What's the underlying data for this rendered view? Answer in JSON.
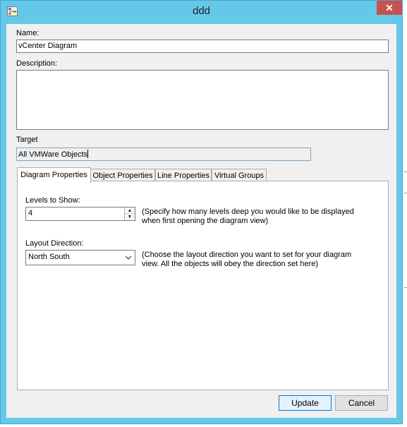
{
  "window": {
    "title": "ddd",
    "close_glyph": "✕",
    "app_icon": "diagram-app-icon"
  },
  "form": {
    "name_label": "Name:",
    "name_value": "vCenter Diagram",
    "description_label": "Description:",
    "description_value": "",
    "target_label": "Target",
    "target_value": "All VMWare Objects"
  },
  "tabs": [
    {
      "label": "Diagram Properties",
      "active": true
    },
    {
      "label": "Object Properties",
      "active": false
    },
    {
      "label": "Line Properties",
      "active": false
    },
    {
      "label": "Virtual Groups",
      "active": false
    }
  ],
  "diagram_properties": {
    "levels_label": "Levels to Show:",
    "levels_value": "4",
    "levels_hint_line1": "(Specify how many levels deep you would like to be displayed",
    "levels_hint_line2": "when first opening the diagram view)",
    "layout_label": "Layout Direction:",
    "layout_value": "North South",
    "layout_hint_line1": "(Choose the layout direction you want to set for your diagram",
    "layout_hint_line2": "view. All the objects will obey the direction set here)"
  },
  "buttons": {
    "update_label": "Update",
    "cancel_label": "Cancel"
  },
  "colors": {
    "titlebar": "#66c8e8",
    "close_button": "#c75050",
    "client_bg": "#f0f0f0",
    "default_button_border": "#0078d7"
  },
  "icons": {
    "spin_up": "▲",
    "spin_down": "▼",
    "dropdown": "⌄"
  }
}
